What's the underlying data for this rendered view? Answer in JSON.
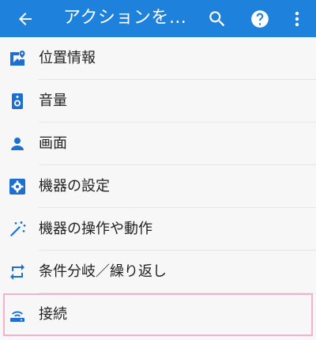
{
  "appbar": {
    "title": "アクションを…",
    "back_icon": "arrow-left-icon",
    "search_icon": "search-icon",
    "help_icon": "help-circle-icon",
    "more_icon": "more-vert-icon",
    "color": "#1e82dc"
  },
  "items": [
    {
      "label": "位置情報",
      "icon": "map-marker-icon"
    },
    {
      "label": "音量",
      "icon": "speaker-icon"
    },
    {
      "label": "画面",
      "icon": "person-icon"
    },
    {
      "label": "機器の設定",
      "icon": "gear-box-icon"
    },
    {
      "label": "機器の操作や動作",
      "icon": "magic-wand-icon"
    },
    {
      "label": "条件分岐／繰り返し",
      "icon": "repeat-icon"
    },
    {
      "label": "接続",
      "icon": "router-icon"
    }
  ],
  "accent_color": "#1e6fd0",
  "highlight_color": "#f4b0cc"
}
